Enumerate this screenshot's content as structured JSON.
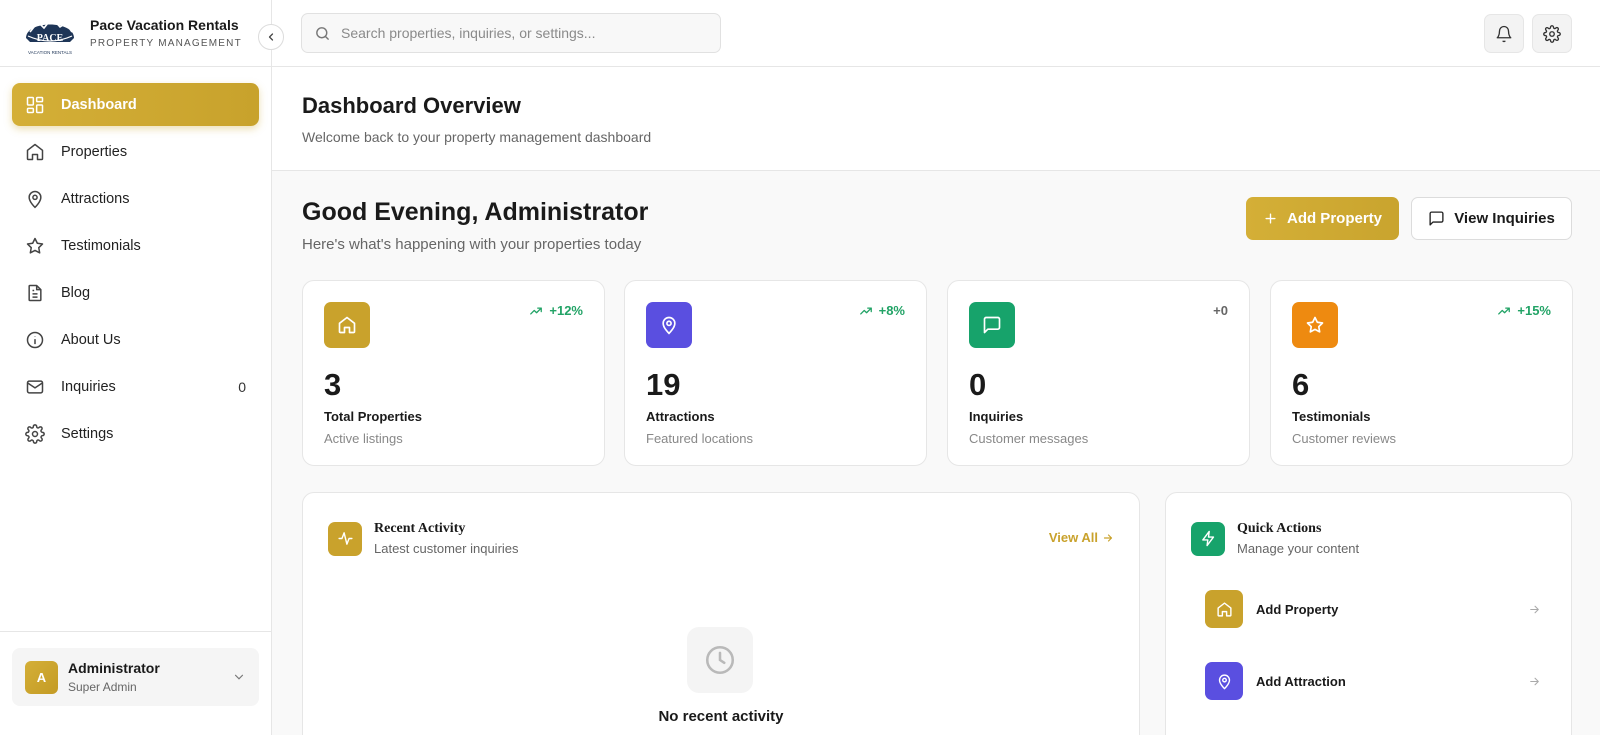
{
  "brand": {
    "name": "Pace Vacation Rentals",
    "subtitle": "PROPERTY MANAGEMENT",
    "logo_text": "PACE",
    "logo_sub": "VACATION RENTALS"
  },
  "sidebar": {
    "items": [
      {
        "label": "Dashboard",
        "icon": "dashboard-icon",
        "active": true
      },
      {
        "label": "Properties",
        "icon": "home-icon"
      },
      {
        "label": "Attractions",
        "icon": "map-pin-icon"
      },
      {
        "label": "Testimonials",
        "icon": "star-icon"
      },
      {
        "label": "Blog",
        "icon": "document-icon"
      },
      {
        "label": "About Us",
        "icon": "info-icon"
      },
      {
        "label": "Inquiries",
        "icon": "mail-icon",
        "count": "0"
      },
      {
        "label": "Settings",
        "icon": "gear-icon"
      }
    ],
    "user": {
      "initial": "A",
      "name": "Administrator",
      "role": "Super Admin"
    }
  },
  "topbar": {
    "search_placeholder": "Search properties, inquiries, or settings..."
  },
  "header": {
    "title": "Dashboard Overview",
    "subtitle": "Welcome back to your property management dashboard"
  },
  "greeting": {
    "title": "Good Evening, Administrator",
    "subtitle": "Here's what's happening with your properties today"
  },
  "actions": {
    "add_property": "Add Property",
    "view_inquiries": "View Inquiries"
  },
  "stats": [
    {
      "value": "3",
      "label": "Total Properties",
      "sub": "Active listings",
      "trend": "+12%",
      "color": "#c9a22c",
      "icon": "home-icon"
    },
    {
      "value": "19",
      "label": "Attractions",
      "sub": "Featured locations",
      "trend": "+8%",
      "color": "#5a4fe0",
      "icon": "map-pin-icon"
    },
    {
      "value": "0",
      "label": "Inquiries",
      "sub": "Customer messages",
      "trend": "+0",
      "color": "#17a36b",
      "icon": "message-icon"
    },
    {
      "value": "6",
      "label": "Testimonials",
      "sub": "Customer reviews",
      "trend": "+15%",
      "color": "#ee8a10",
      "icon": "star-icon"
    }
  ],
  "recent_activity": {
    "title": "Recent Activity",
    "subtitle": "Latest customer inquiries",
    "view_all": "View All",
    "empty_title": "No recent activity"
  },
  "quick_actions": {
    "title": "Quick Actions",
    "subtitle": "Manage your content",
    "items": [
      {
        "label": "Add Property",
        "color": "#c9a22c",
        "icon": "home-icon"
      },
      {
        "label": "Add Attraction",
        "color": "#5a4fe0",
        "icon": "map-pin-icon"
      }
    ]
  },
  "colors": {
    "accent": "#c9a22c",
    "success": "#22a366"
  }
}
